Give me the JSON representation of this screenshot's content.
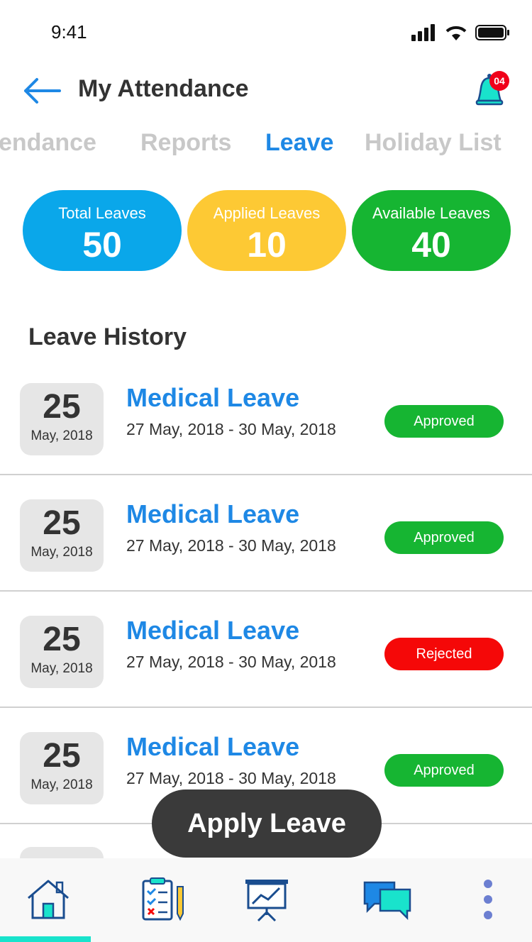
{
  "status_bar": {
    "time": "9:41"
  },
  "header": {
    "title": "My Attendance",
    "notification_count": "04"
  },
  "tabs": [
    {
      "label": "Attendance",
      "visible_text": "endance"
    },
    {
      "label": "Reports"
    },
    {
      "label": "Leave",
      "active": true
    },
    {
      "label": "Holiday List"
    }
  ],
  "summary": {
    "total": {
      "label": "Total Leaves",
      "value": "50",
      "color": "#0aa7ea"
    },
    "applied": {
      "label": "Applied Leaves",
      "value": "10",
      "color": "#fdc934"
    },
    "available": {
      "label": "Available Leaves",
      "value": "40",
      "color": "#16b532"
    }
  },
  "history": {
    "heading": "Leave History",
    "items": [
      {
        "day": "25",
        "month": "May, 2018",
        "type": "Medical Leave",
        "range": "27 May, 2018 - 30 May, 2018",
        "status": "Approved",
        "status_color": "#16b532"
      },
      {
        "day": "25",
        "month": "May, 2018",
        "type": "Medical Leave",
        "range": "27 May, 2018 - 30 May, 2018",
        "status": "Approved",
        "status_color": "#16b532"
      },
      {
        "day": "25",
        "month": "May, 2018",
        "type": "Medical Leave",
        "range": "27 May, 2018 - 30 May, 2018",
        "status": "Rejected",
        "status_color": "#f50808"
      },
      {
        "day": "25",
        "month": "May, 2018",
        "type": "Medical Leave",
        "range": "27 May, 2018 - 30 May, 2018",
        "status": "Approved",
        "status_color": "#16b532"
      }
    ]
  },
  "fab": {
    "label": "Apply Leave"
  },
  "bottom_nav": [
    {
      "icon": "home-icon",
      "active": true
    },
    {
      "icon": "clipboard-checklist-icon"
    },
    {
      "icon": "presentation-chart-icon"
    },
    {
      "icon": "chat-bubbles-icon"
    },
    {
      "icon": "more-vertical-icon"
    }
  ],
  "colors": {
    "accent": "#1e88e5",
    "active_indicator": "#19e3cc"
  }
}
